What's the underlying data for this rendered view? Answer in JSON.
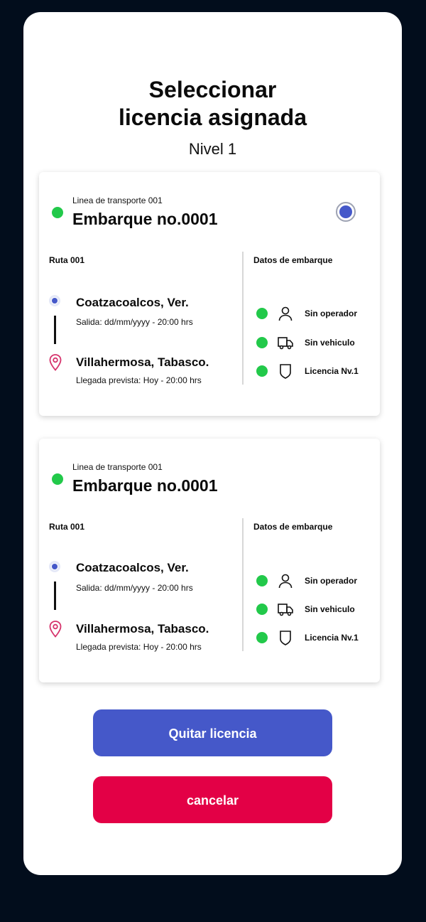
{
  "title_line1": "Seleccionar",
  "title_line2": "licencia asignada",
  "subtitle": "Nivel 1",
  "cards": [
    {
      "carrier": "Linea de transporte 001",
      "shipment": "Embarque no.0001",
      "selected": true,
      "route_label": "Ruta 001",
      "origin_city": "Coatzacoalcos, Ver.",
      "departure": "Salida: dd/mm/yyyy - 20:00 hrs",
      "destination_city": "Villahermosa, Tabasco.",
      "arrival": "Llegada prevista: Hoy - 20:00 hrs",
      "details_label": "Datos de embarque",
      "statuses": [
        {
          "icon": "user-icon",
          "label": "Sin operador",
          "color": "#22c94a"
        },
        {
          "icon": "truck-icon",
          "label": "Sin vehiculo",
          "color": "#22c94a"
        },
        {
          "icon": "shield-icon",
          "label": "Licencia Nv.1",
          "color": "#22c94a"
        }
      ]
    },
    {
      "carrier": "Linea de transporte 001",
      "shipment": "Embarque no.0001",
      "selected": false,
      "route_label": "Ruta 001",
      "origin_city": "Coatzacoalcos, Ver.",
      "departure": "Salida: dd/mm/yyyy - 20:00 hrs",
      "destination_city": "Villahermosa, Tabasco.",
      "arrival": "Llegada prevista: Hoy - 20:00 hrs",
      "details_label": "Datos de embarque",
      "statuses": [
        {
          "icon": "user-icon",
          "label": "Sin operador",
          "color": "#22c94a"
        },
        {
          "icon": "truck-icon",
          "label": "Sin vehiculo",
          "color": "#22c94a"
        },
        {
          "icon": "shield-icon",
          "label": "Licencia Nv.1",
          "color": "#22c94a"
        }
      ]
    }
  ],
  "buttons": {
    "primary_label": "Quitar licencia",
    "cancel_label": "cancelar"
  },
  "colors": {
    "background": "#020d1c",
    "accent_blue": "#4558c9",
    "danger": "#e30046",
    "status_green": "#22c94a",
    "pin_pink": "#d6336c"
  }
}
